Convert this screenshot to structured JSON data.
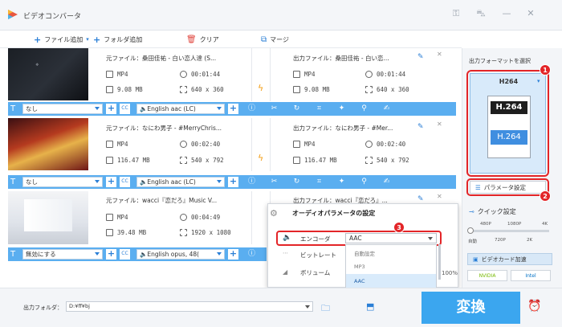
{
  "app": {
    "title": "ビデオコンバータ"
  },
  "toolbar": {
    "add_file": "ファイル追加",
    "add_folder": "フォルダ追加",
    "clear": "クリア",
    "merge": "マージ"
  },
  "files": [
    {
      "source_name": "元ファイル：桑田佳祐 - 白い恋人達 (S...",
      "output_name": "出力ファイル：桑田佳祐 - 白い恋...",
      "src_format": "MP4",
      "src_duration": "00:01:44",
      "src_size": "9.08 MB",
      "src_res": "640 x 360",
      "out_format": "MP4",
      "out_duration": "00:01:44",
      "out_size": "9.08 MB",
      "out_res": "640 x 360",
      "subtitle": "なし",
      "audio": "English aac (LC)"
    },
    {
      "source_name": "元ファイル：なにわ男子 - #MerryChris...",
      "output_name": "出力ファイル：なにわ男子 - #Mer...",
      "src_format": "MP4",
      "src_duration": "00:02:40",
      "src_size": "116.47 MB",
      "src_res": "540 x 792",
      "out_format": "MP4",
      "out_duration": "00:02:40",
      "out_size": "116.47 MB",
      "out_res": "540 x 792",
      "subtitle": "なし",
      "audio": "English aac (LC)"
    },
    {
      "source_name": "元ファイル：wacci『恋だろ』Music V...",
      "output_name": "出力ファイル：wacci『恋だろ』...",
      "src_format": "MP4",
      "src_duration": "00:04:49",
      "src_size": "39.48 MB",
      "src_res": "1920 x 1080",
      "subtitle": "無効にする",
      "audio": "English opus, 48("
    }
  ],
  "right_panel": {
    "select_format_label": "出力フォーマットを選択",
    "format_name": "H264",
    "format_badge_top": "H.264",
    "format_badge_bottom": "H.264",
    "param_button": "パラメータ設定",
    "quick_setting": "クイック設定",
    "quality_top": [
      "480P",
      "1080P",
      "4K"
    ],
    "quality_bottom": [
      "自動",
      "720P",
      "2K"
    ],
    "gpu_accel": "ビデオカード加速",
    "gpu_nvidia": "NVIDIA",
    "gpu_intel": "Intel",
    "slider_level": 0.0
  },
  "audio_popup": {
    "title": "オーディオパラメータの設定",
    "encoder_label": "エンコーダ",
    "encoder_value": "AAC",
    "bitrate_label": "ビットレート",
    "volume_label": "ボリューム",
    "volume_value": "100%",
    "options": [
      "自動設定",
      "MP3",
      "AAC"
    ],
    "selected_index": 2
  },
  "callouts": [
    "1",
    "2",
    "3"
  ],
  "bottom": {
    "output_folder_label": "出力フォルダ：",
    "output_folder_path": "D:¥ff¥bj",
    "convert_button": "変換"
  },
  "colors": {
    "accent": "#2b7fd6",
    "bar": "#5aaef0",
    "convert": "#3ba6ef",
    "callout": "#e32528"
  }
}
